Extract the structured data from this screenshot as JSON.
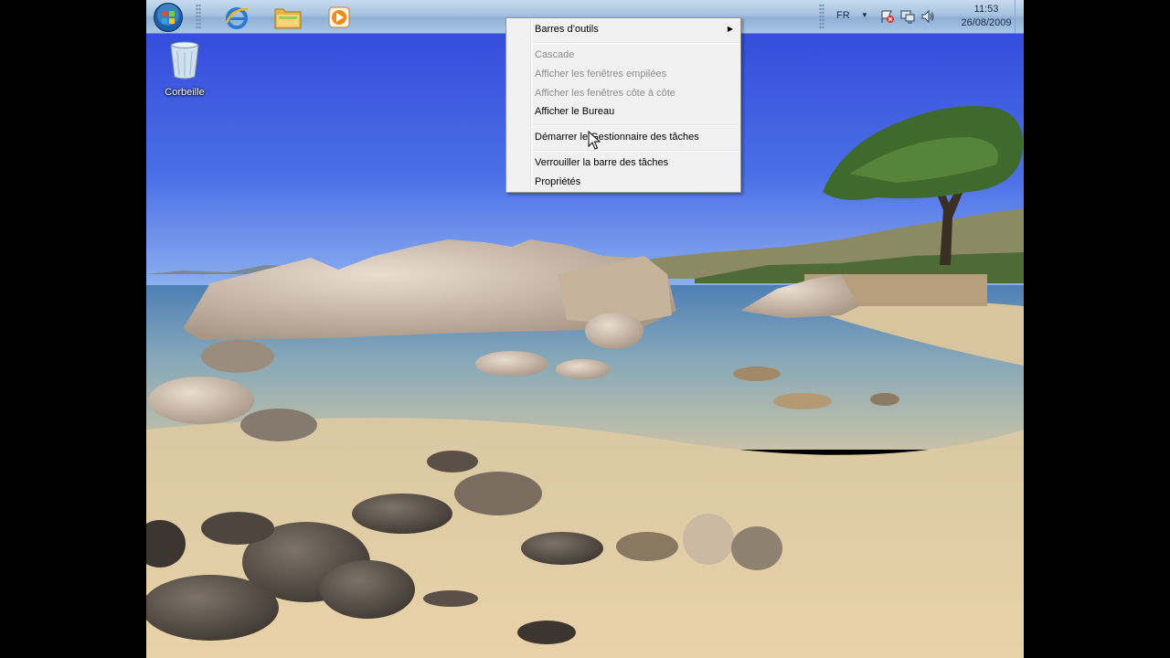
{
  "desktop": {
    "recycle_bin_label": "Corbeille"
  },
  "taskbar": {
    "pinned": [
      "windows-start-orb",
      "internet-explorer-icon",
      "file-explorer-icon",
      "media-player-icon"
    ],
    "language": "FR",
    "clock_time": "11:53",
    "clock_date": "26/08/2009"
  },
  "context_menu": {
    "toolbars": "Barres d’outils",
    "cascade": "Cascade",
    "stacked": "Afficher les fenêtres empilées",
    "side_by_side": "Afficher les fenêtres côte à côte",
    "show_desktop": "Afficher le Bureau",
    "task_manager": "Démarrer le Gestionnaire des tâches",
    "lock_taskbar": "Verrouiller la barre des tâches",
    "properties": "Propriétés"
  },
  "colors": {
    "sky": "#3f5fe0",
    "water": "#6f9cc0",
    "sand": "#e5cfa5",
    "menu_bg": "#f1f1f1",
    "disabled_text": "#8d8d8d"
  }
}
